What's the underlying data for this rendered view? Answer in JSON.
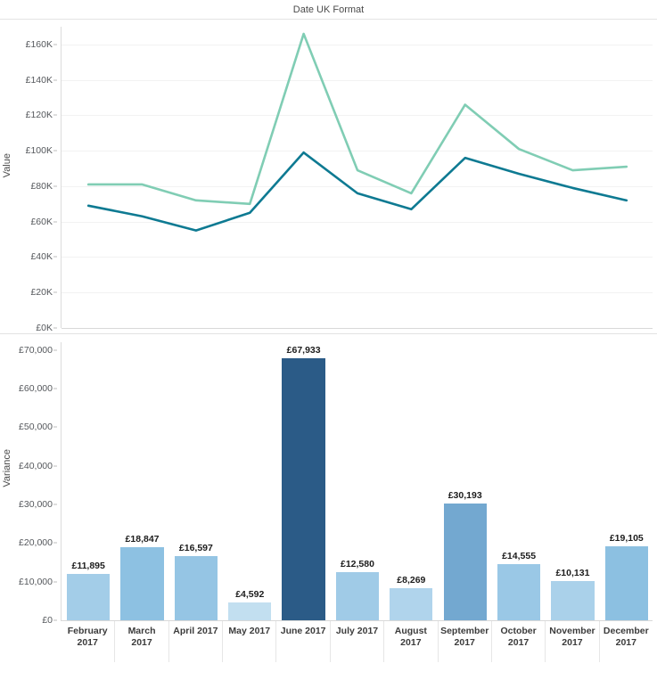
{
  "title": "Date UK Format",
  "chart_data": [
    {
      "type": "line",
      "title": "Date UK Format",
      "xlabel": "",
      "ylabel": "Value",
      "ylim": [
        0,
        170000
      ],
      "ytick_labels": [
        "£0K",
        "£20K",
        "£40K",
        "£60K",
        "£80K",
        "£100K",
        "£120K",
        "£140K",
        "£160K"
      ],
      "ytick_values": [
        0,
        20000,
        40000,
        60000,
        80000,
        100000,
        120000,
        140000,
        160000
      ],
      "grid": true,
      "legend": "none",
      "categories": [
        "February 2017",
        "March 2017",
        "April 2017",
        "May 2017",
        "June 2017",
        "July 2017",
        "August 2017",
        "September 2017",
        "October 2017",
        "November 2017",
        "December 2017"
      ],
      "series": [
        {
          "name": "Light Teal Line",
          "color": "#80cdb4",
          "values": [
            81000,
            81000,
            72000,
            70000,
            166000,
            89000,
            76000,
            126000,
            101000,
            89000,
            91000
          ]
        },
        {
          "name": "Dark Teal Line",
          "color": "#0e7a92",
          "values": [
            69000,
            63000,
            55000,
            65000,
            99000,
            76000,
            67000,
            96000,
            87000,
            79000,
            72000
          ]
        }
      ]
    },
    {
      "type": "bar",
      "title": "",
      "xlabel": "",
      "ylabel": "Variance",
      "ylim": [
        0,
        72000
      ],
      "ytick_labels": [
        "£0",
        "£10,000",
        "£20,000",
        "£30,000",
        "£40,000",
        "£50,000",
        "£60,000",
        "£70,000"
      ],
      "ytick_values": [
        0,
        10000,
        20000,
        30000,
        40000,
        50000,
        60000,
        70000
      ],
      "grid": false,
      "legend": "none",
      "categories": [
        "February\n2017",
        "March\n2017",
        "April 2017",
        "May 2017",
        "June 2017",
        "July 2017",
        "August\n2017",
        "September\n2017",
        "October\n2017",
        "November\n2017",
        "December\n2017"
      ],
      "values": [
        11895,
        18847,
        16597,
        4592,
        67933,
        12580,
        8269,
        30193,
        14555,
        10131,
        19105
      ],
      "value_labels": [
        "£11,895",
        "£18,847",
        "£16,597",
        "£4,592",
        "£67,933",
        "£12,580",
        "£8,269",
        "£30,193",
        "£14,555",
        "£10,131",
        "£19,105"
      ],
      "bar_colors": [
        "#a3cde8",
        "#8dc1e2",
        "#95c5e4",
        "#c2dff0",
        "#2b5b87",
        "#a0cbe7",
        "#b0d4ec",
        "#73a8d0",
        "#9ac8e6",
        "#aad1ea",
        "#8cc0e1"
      ]
    }
  ]
}
